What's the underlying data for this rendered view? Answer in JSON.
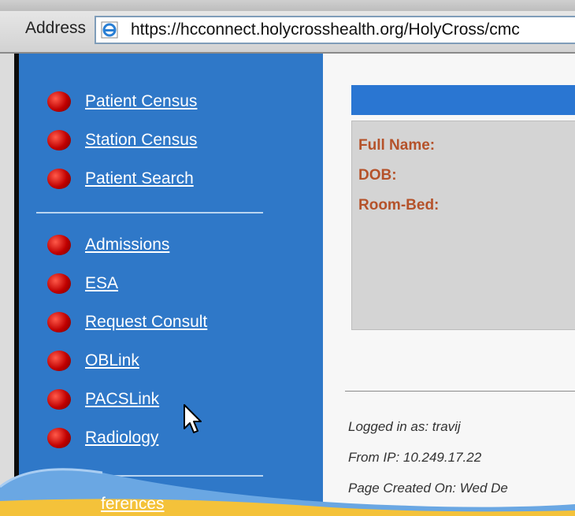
{
  "browser": {
    "address_label": "Address",
    "url": "https://hcconnect.holycrosshealth.org/HolyCross/cmc"
  },
  "sidebar": {
    "group1": [
      {
        "label": "Patient Census"
      },
      {
        "label": "Station Census"
      },
      {
        "label": "Patient Search"
      }
    ],
    "group2": [
      {
        "label": "Admissions"
      },
      {
        "label": "ESA"
      },
      {
        "label": "Request Consult"
      },
      {
        "label": "OBLink"
      },
      {
        "label": "PACSLink"
      },
      {
        "label": "Radiology"
      }
    ],
    "partial_item": "ferences"
  },
  "patient_panel": {
    "full_name_label": "Full Name:",
    "dob_label": "DOB:",
    "room_bed_label": "Room-Bed:"
  },
  "footer": {
    "logged_in": "Logged in as: travij",
    "from_ip": "From IP: 10.249.17.22",
    "page_created": "Page Created On: Wed De"
  },
  "colors": {
    "sidebar_bg": "#2f78c8",
    "panel_header": "#2a76d2",
    "field_label": "#b5522a",
    "bullet": "#c00000"
  }
}
